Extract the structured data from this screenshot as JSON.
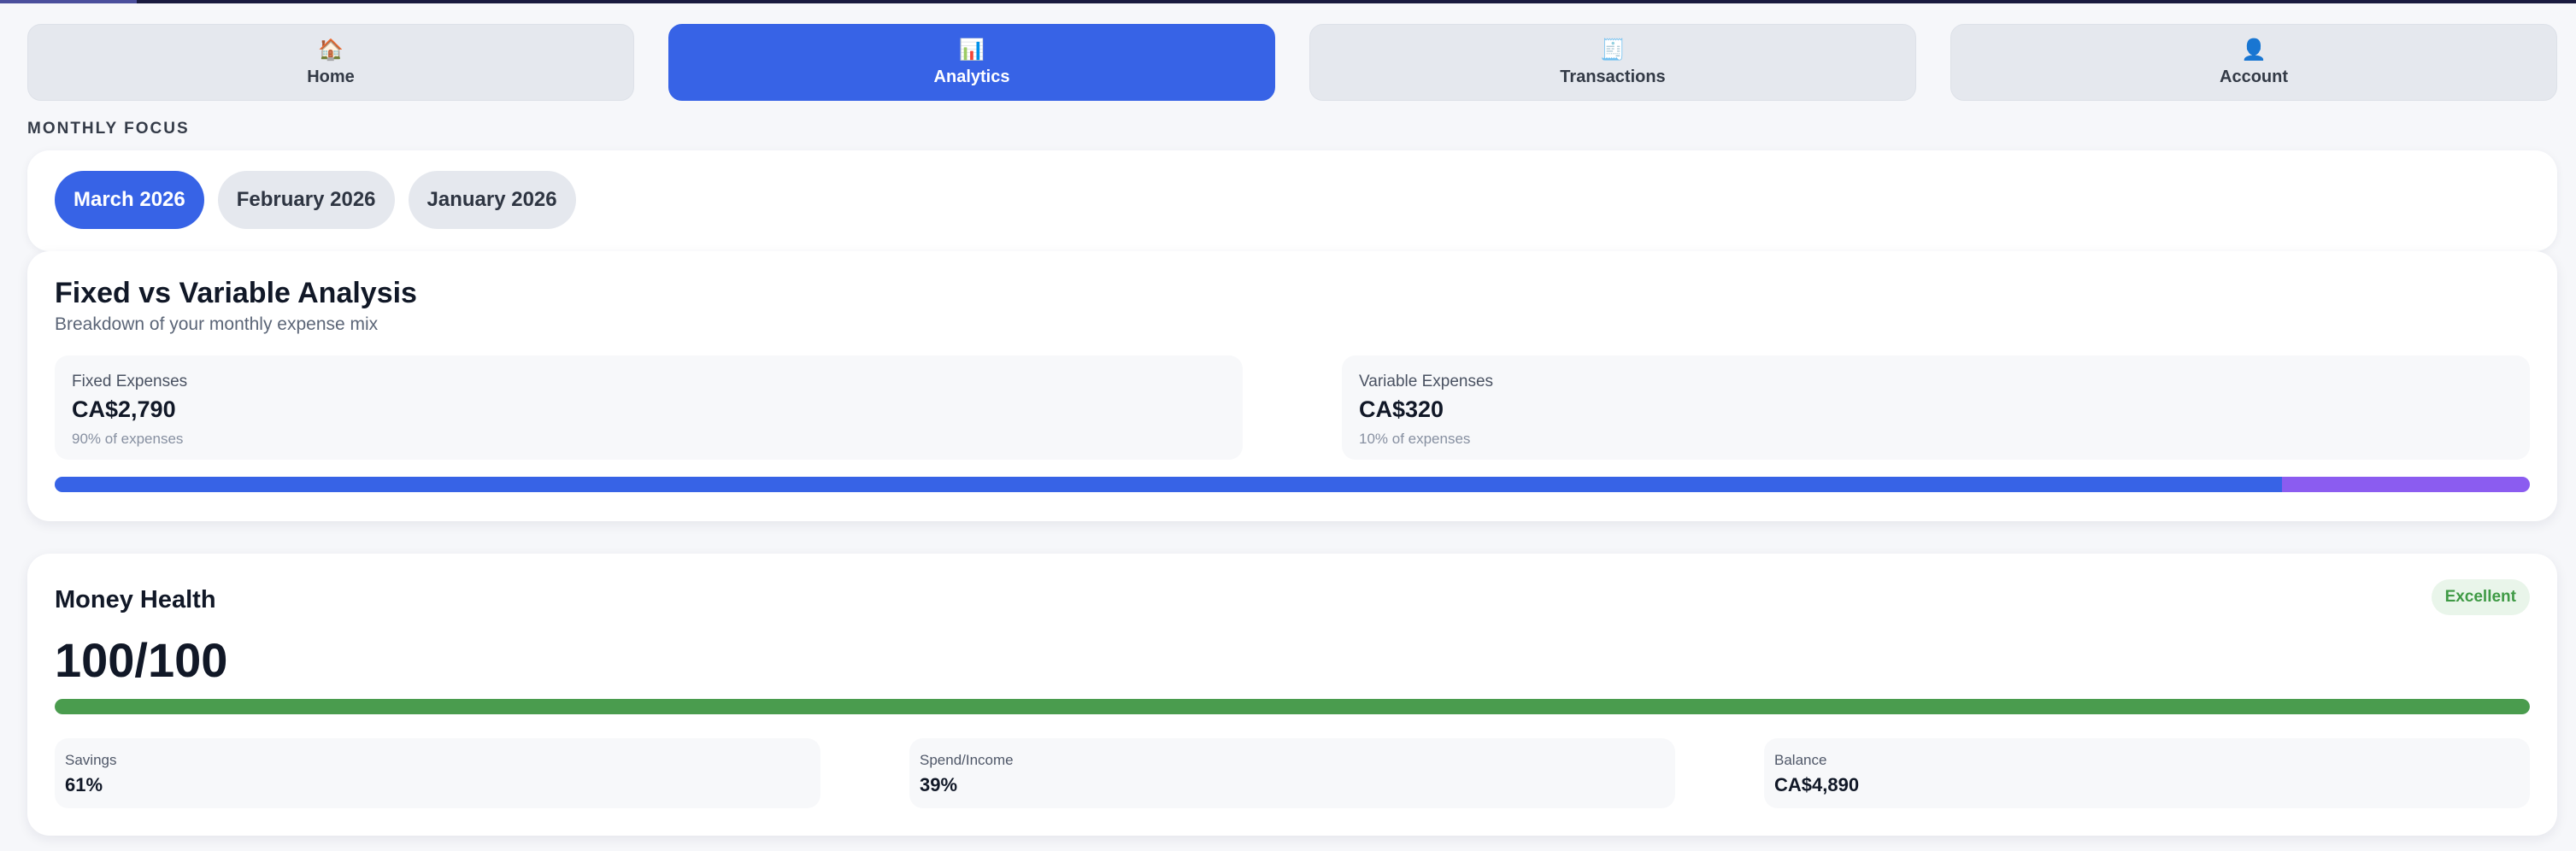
{
  "nav": {
    "tabs": [
      {
        "label": "Home",
        "icon": "🏠",
        "icon_name": "home-icon",
        "active": false
      },
      {
        "label": "Analytics",
        "icon": "📊",
        "icon_name": "bar-chart-icon",
        "active": true
      },
      {
        "label": "Transactions",
        "icon": "🧾",
        "icon_name": "receipt-icon",
        "active": false
      },
      {
        "label": "Account",
        "icon": "👤",
        "icon_name": "user-icon",
        "active": false
      }
    ]
  },
  "monthly_focus": {
    "label": "MONTHLY FOCUS",
    "months": [
      {
        "label": "March 2026",
        "active": true
      },
      {
        "label": "February 2026",
        "active": false
      },
      {
        "label": "January 2026",
        "active": false
      }
    ]
  },
  "fixed_variable": {
    "title": "Fixed vs Variable Analysis",
    "subtitle": "Breakdown of your monthly expense mix",
    "fixed": {
      "label": "Fixed Expenses",
      "value": "CA$2,790",
      "note": "90% of expenses",
      "percent": 90,
      "color": "#3763e6"
    },
    "variable": {
      "label": "Variable Expenses",
      "value": "CA$320",
      "note": "10% of expenses",
      "percent": 10,
      "color": "#8b5cf0"
    }
  },
  "money_health": {
    "title": "Money Health",
    "badge": "Excellent",
    "score": "100/100",
    "score_fraction": 1.0,
    "stats": [
      {
        "label": "Savings",
        "value": "61%"
      },
      {
        "label": "Spend/Income",
        "value": "39%"
      },
      {
        "label": "Balance",
        "value": "CA$4,890"
      }
    ]
  },
  "colors": {
    "accent": "#3763e6",
    "health_green": "#4a9c4e",
    "badge_text": "#3f9a45",
    "badge_bg": "#e9f5ea"
  }
}
